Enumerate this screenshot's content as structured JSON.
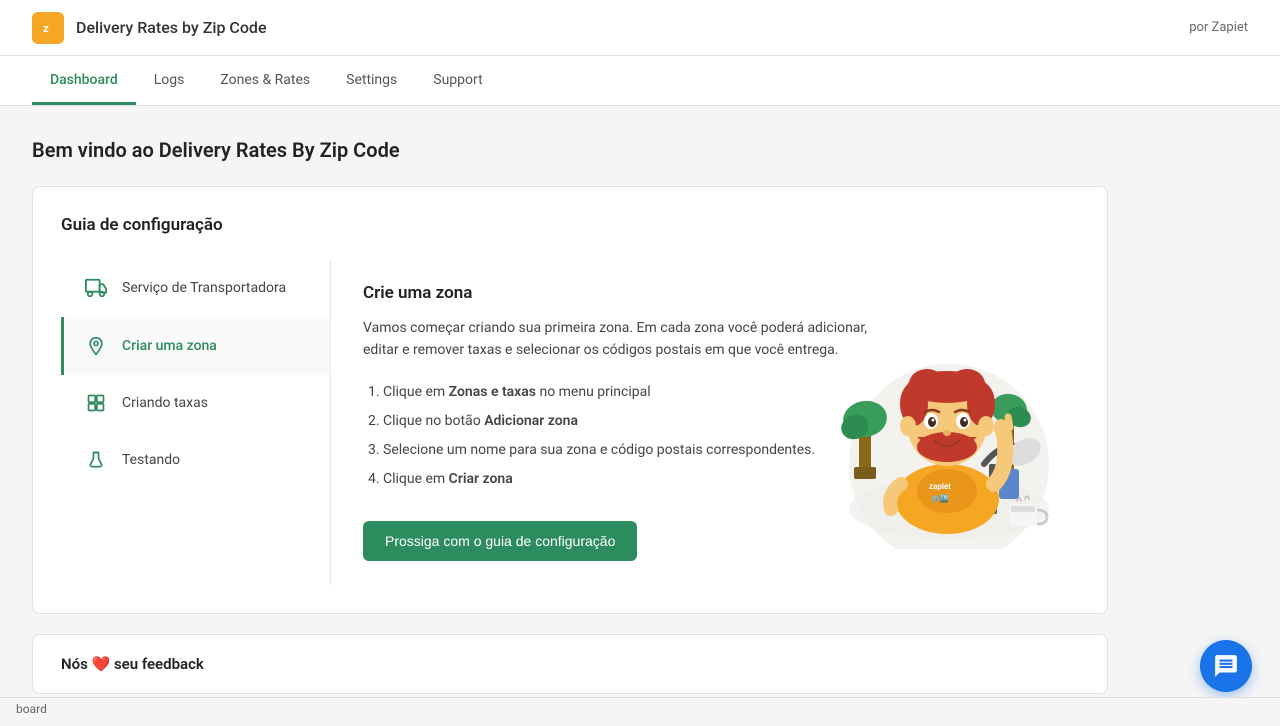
{
  "header": {
    "logo_text": "z",
    "title": "Delivery Rates by Zip Code",
    "brand": "por Zapiet"
  },
  "nav": {
    "items": [
      {
        "id": "dashboard",
        "label": "Dashboard",
        "active": true
      },
      {
        "id": "logs",
        "label": "Logs",
        "active": false
      },
      {
        "id": "zones-rates",
        "label": "Zones & Rates",
        "active": false
      },
      {
        "id": "settings",
        "label": "Settings",
        "active": false
      },
      {
        "id": "support",
        "label": "Support",
        "active": false
      }
    ]
  },
  "main": {
    "page_title": "Bem vindo ao Delivery Rates By Zip Code",
    "setup_guide": {
      "card_title": "Guia de configuração",
      "sidebar_items": [
        {
          "id": "transportadora",
          "label": "Serviço de Transportadora",
          "icon": "truck",
          "active": false
        },
        {
          "id": "criar-zona",
          "label": "Criar uma zona",
          "icon": "location",
          "active": true
        },
        {
          "id": "criando-taxas",
          "label": "Criando taxas",
          "icon": "tag",
          "active": false
        },
        {
          "id": "testando",
          "label": "Testando",
          "icon": "beaker",
          "active": false
        }
      ],
      "content": {
        "title": "Crie uma zona",
        "description": "Vamos começar criando sua primeira zona. Em cada zona você poderá adicionar, editar e remover taxas e selecionar os códigos postais em que você entrega.",
        "steps": [
          {
            "text": "Clique em ",
            "bold": "Zonas e taxas",
            "suffix": " no menu principal"
          },
          {
            "text": "Clique no botão ",
            "bold": "Adicionar zona",
            "suffix": ""
          },
          {
            "text": "Selecione um nome para sua zona e código postais correspondentes.",
            "bold": "",
            "suffix": ""
          },
          {
            "text": "Clique em ",
            "bold": "Criar zona",
            "suffix": ""
          }
        ],
        "button_label": "Prossiga com o guia de configuração"
      }
    },
    "feedback_card": {
      "title": "Nós ❤️ seu feedback"
    }
  },
  "chat_button": {
    "aria_label": "Chat"
  },
  "status_bar": {
    "text": "board"
  }
}
